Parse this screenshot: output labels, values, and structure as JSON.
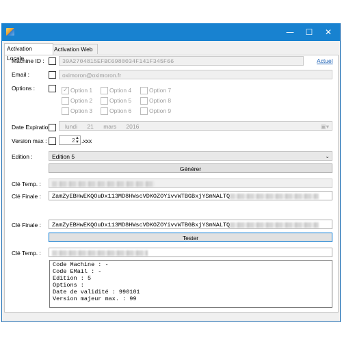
{
  "window": {
    "min_symbol": "—",
    "max_symbol": "☐",
    "close_symbol": "✕"
  },
  "tabs": [
    {
      "label": "Activation Locale",
      "active": true
    },
    {
      "label": "Activation Web",
      "active": false
    }
  ],
  "machine_id": {
    "label": "Machine ID :",
    "value": "39A2704815EFBC6980034F141F345F66",
    "link": "Actuel"
  },
  "email": {
    "label": "Email :",
    "value": "oximoron@oximoron.fr"
  },
  "options": {
    "label": "Options :",
    "items": [
      {
        "label": "Option 1",
        "checked": true
      },
      {
        "label": "Option 2",
        "checked": false
      },
      {
        "label": "Option 3",
        "checked": false
      },
      {
        "label": "Option 4",
        "checked": false
      },
      {
        "label": "Option 5",
        "checked": false
      },
      {
        "label": "Option 6",
        "checked": false
      },
      {
        "label": "Option 7",
        "checked": false
      },
      {
        "label": "Option 8",
        "checked": false
      },
      {
        "label": "Option 9",
        "checked": false
      }
    ]
  },
  "date_expiration": {
    "label": "Date Expiration :",
    "weekday": "lundi",
    "day": "21",
    "month": "mars",
    "year": "2016"
  },
  "version_max": {
    "label": "Version max :",
    "value": "2",
    "suffix": ".xxx"
  },
  "edition": {
    "label": "Edition :",
    "selected": "Edition 5"
  },
  "generate_button": "Générer",
  "cle_temp_1": {
    "label": "Clé Temp. :"
  },
  "cle_finale_1": {
    "label": "Clé Finale :",
    "value": "ZamZyEBHwEKQOuDx113MD8HWscVDKOZOYivvWTBGBxjYSmNALTQ"
  },
  "cle_finale_2": {
    "label": "Clé Finale :",
    "value": "ZamZyEBHwEKQOuDx113MD8HWscVDKOZOYivvWTBGBxjYSmNALTQ"
  },
  "test_button": "Tester",
  "cle_temp_2": {
    "label": "Clé Temp. :"
  },
  "result_text": "Code Machine : -\nCode EMail : -\nEdition : 5\nOptions :\nDate de validité : 990101\nVersion majeur max. : 99"
}
